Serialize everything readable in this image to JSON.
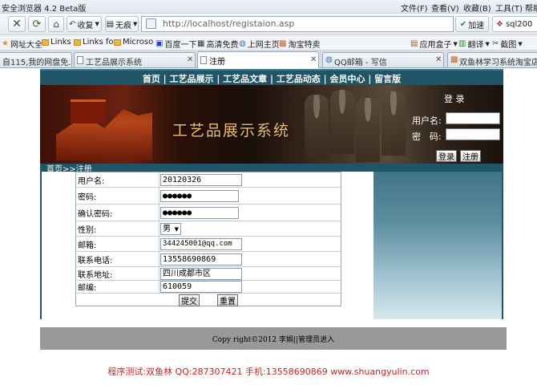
{
  "browser": {
    "title": "安全浏览器 4.2 Beta版",
    "menu": [
      "文件(F)",
      "查看(V)",
      "收藏(B)",
      "工具(T)",
      "帮助"
    ],
    "back_label": "收复",
    "tools_label": "无痕",
    "address": "http://localhost/registaion.asp",
    "speedup_label": "加速",
    "search_value": "sql200",
    "favorites": [
      "网址大全",
      "Links",
      "Links fo",
      "Microso",
      "百度一下",
      "高清免费",
      "上网主页",
      "淘宝特卖",
      "应用盒子",
      "翻译",
      "截图"
    ],
    "tabs": [
      {
        "label": "自115,我的网盘免...",
        "active": false
      },
      {
        "label": "工艺品展示系统",
        "active": false
      },
      {
        "label": "注册",
        "active": true
      },
      {
        "label": "QQ邮箱 - 写信",
        "active": false
      },
      {
        "label": "双鱼林学习系统淘宝店 - 上",
        "active": false
      }
    ]
  },
  "site": {
    "nav": "首页 | 工艺品展示 | 工艺品文章 | 工艺品动态 | 会员中心 | 留言版",
    "banner_title": "工艺品展示系统",
    "login": {
      "title": "登 录",
      "username_label": "用户名:",
      "password_label": "密　码:",
      "login_button": "登录",
      "register_button": "注册"
    },
    "breadcrumb": "首页>>注册",
    "form": {
      "username_label": "用户名:",
      "username_value": "20120326",
      "password_label": "密码:",
      "password_value": "●●●●●●",
      "confirm_label": "确认密码:",
      "confirm_value": "●●●●●●",
      "gender_label": "性别:",
      "gender_value": "男",
      "email_label": "邮箱:",
      "email_value": "344245001@qq.com",
      "phone_label": "联系电话:",
      "phone_value": "13558690869",
      "address_label": "联系地址:",
      "address_value": "四川成都市区",
      "zip_label": "邮编:",
      "zip_value": "610059",
      "submit_label": "提交",
      "reset_label": "重置"
    },
    "footer": "Copy right©2012 李娟||管理员进入",
    "credit": "程序测试:双鱼林 QQ:287307421 手机:13558690869 www.shuangyulin.com"
  }
}
